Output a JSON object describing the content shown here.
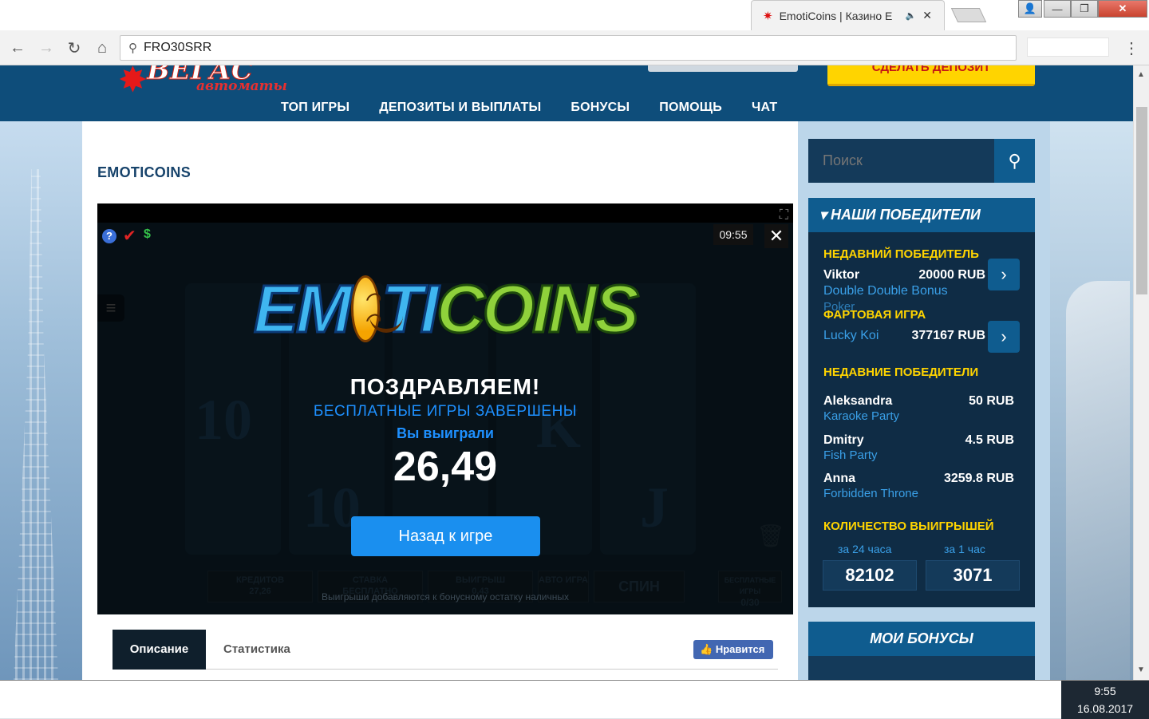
{
  "browser": {
    "tab_title": "EmotiCoins | Казино Е",
    "address": "FRO30SRR",
    "window_buttons": {
      "user": "👤",
      "min": "—",
      "max": "❐",
      "close": "✕"
    }
  },
  "site": {
    "nav": [
      "ТОП ИГРЫ",
      "ДЕПОЗИТЫ И ВЫПЛАТЫ",
      "БОНУСЫ",
      "ПОМОЩЬ",
      "ЧАТ"
    ],
    "deposit_label": "СДЕЛАТЬ ДЕПОЗИТ",
    "logo_brand": "ВЕГАС",
    "logo_sub": "автоматы"
  },
  "game": {
    "title": "EMOTICOINS",
    "timer": "09:55",
    "overlay": {
      "congrats": "ПОЗДРАВЛЯЕМ!",
      "free_done": "БЕСПЛАТНЫЕ ИГРЫ ЗАВЕРШЕНЫ",
      "you_won": "Вы выиграли",
      "amount": "26,49",
      "back_button": "Назад к игре"
    },
    "bottom": {
      "credits_label": "КРЕДИТОВ",
      "credits_value": "27,26",
      "bet_label": "СТАВКА",
      "bet_value": "БЕСПЛАТНО",
      "win_label": "ВЫИГРЫШ",
      "win_value": "0,43",
      "auto_label": "АВТО ИГРА",
      "spin_label": "СПИН",
      "free_label": "БЕСПЛАТНЫЕ ИГРЫ",
      "free_value": "0/30",
      "note": "Выигрыши добавляются к бонусному остатку наличных"
    },
    "logo_parts": {
      "a": "EM",
      "b": "TI",
      "c": "COINS"
    }
  },
  "tabs": {
    "description": "Описание",
    "stats": "Статистика",
    "like": "Нравится"
  },
  "sidebar": {
    "search_placeholder": "Поиск",
    "winners_title": "НАШИ ПОБЕДИТЕЛИ",
    "recent_winner_label": "НЕДАВНИЙ ПОБЕДИТЕЛЬ",
    "recent_winner": {
      "name": "Viktor",
      "amount": "20000 RUB",
      "game": "Double Double Bonus",
      "game_overflow": "Poker"
    },
    "lucky_label": "ФАРТОВАЯ ИГРА",
    "lucky": {
      "game": "Lucky Koi",
      "amount": "377167 RUB"
    },
    "recent_winners_label": "НЕДАВНИЕ ПОБЕДИТЕЛИ",
    "recent_winners": [
      {
        "name": "Aleksandra",
        "amount": "50 RUB",
        "game": "Karaoke Party"
      },
      {
        "name": "Dmitry",
        "amount": "4.5 RUB",
        "game": "Fish Party"
      },
      {
        "name": "Anna",
        "amount": "3259.8 RUB",
        "game": "Forbidden Throne"
      }
    ],
    "wins_count_label": "КОЛИЧЕСТВО ВЫИГРЫШЕЙ",
    "wins_24h_label": "за 24 часа",
    "wins_24h": "82102",
    "wins_1h_label": "за 1 час",
    "wins_1h": "3071",
    "bonuses_title": "МОИ БОНУСЫ"
  },
  "taskbar": {
    "time": "9:55",
    "date": "16.08.2017"
  }
}
